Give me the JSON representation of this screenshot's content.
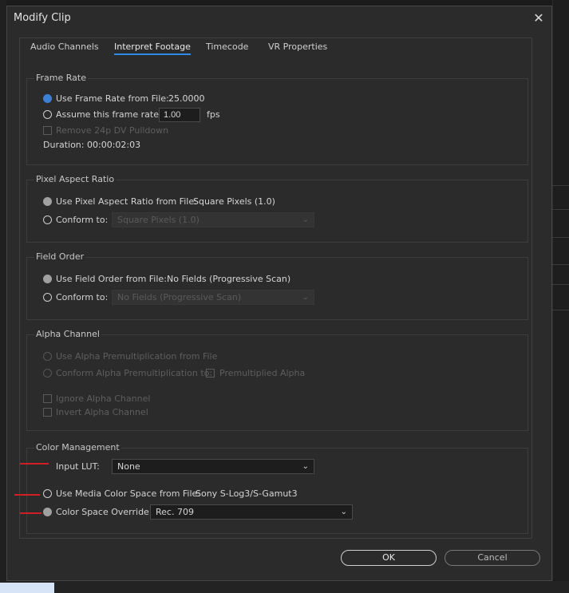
{
  "window": {
    "title": "Modify Clip",
    "close_glyph": "✕"
  },
  "tabs": [
    "Audio Channels",
    "Interpret Footage",
    "Timecode",
    "VR Properties"
  ],
  "frame_rate": {
    "title": "Frame Rate",
    "use_from_file_label": "Use Frame Rate from File:",
    "use_from_file_value": "25.0000",
    "assume_label": "Assume this frame rate:",
    "assume_value": "1.00",
    "fps_label": "fps",
    "pulldown_label": "Remove 24p DV Pulldown",
    "duration_label": "Duration:",
    "duration_value": "00:00:02:03"
  },
  "pixel_aspect": {
    "title": "Pixel Aspect Ratio",
    "use_from_file_label": "Use Pixel Aspect Ratio from File:",
    "use_from_file_value": "Square Pixels (1.0)",
    "conform_label": "Conform to:",
    "conform_value": "Square Pixels (1.0)"
  },
  "field_order": {
    "title": "Field Order",
    "use_from_file_label": "Use Field Order from File:",
    "use_from_file_value": "No Fields (Progressive Scan)",
    "conform_label": "Conform to:",
    "conform_value": "No Fields (Progressive Scan)"
  },
  "alpha": {
    "title": "Alpha Channel",
    "use_premult_label": "Use Alpha Premultiplication from File",
    "conform_premult_label": "Conform Alpha Premultiplication to:",
    "premult_check_label": "Premultiplied Alpha",
    "ignore_label": "Ignore Alpha Channel",
    "invert_label": "Invert Alpha Channel"
  },
  "color": {
    "title": "Color Management",
    "input_lut_label": "Input LUT:",
    "input_lut_value": "None",
    "use_media_label": "Use Media Color Space from File:",
    "use_media_value": "Sony S-Log3/S-Gamut3",
    "override_label": "Color Space Override:",
    "override_value": "Rec. 709"
  },
  "buttons": {
    "ok": "OK",
    "cancel": "Cancel"
  },
  "icons": {
    "dropdown": "chevron-down-icon",
    "close": "close-icon"
  },
  "colors": {
    "accent": "#3b82d6",
    "annotation": "#d01f27"
  }
}
